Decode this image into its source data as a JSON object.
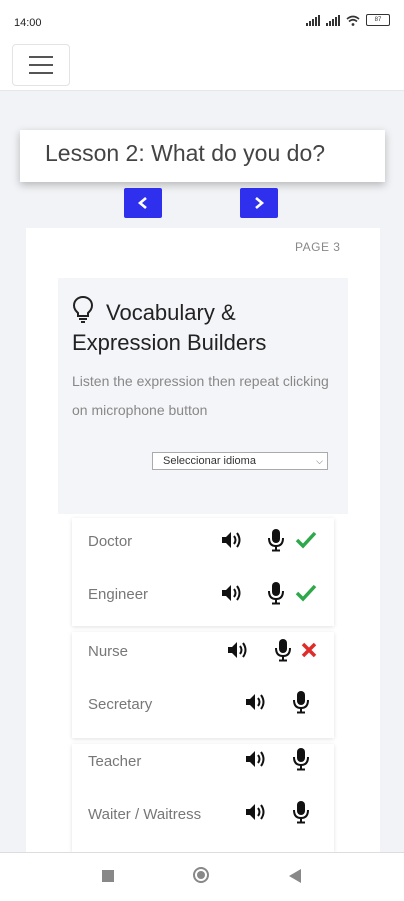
{
  "status_bar": {
    "time": "14:00",
    "battery": "87"
  },
  "lesson": {
    "title": "Lesson 2: What do you do?",
    "prev_label": "<",
    "next_label": ">"
  },
  "page": {
    "number_label": "PAGE 3"
  },
  "vocab": {
    "title": "Vocabulary & Expression Builders",
    "description": "Listen the expression then repeat clicking on microphone button",
    "language_select": "Seleccionar idioma"
  },
  "words": [
    {
      "text": "Doctor",
      "result": "correct"
    },
    {
      "text": "Engineer",
      "result": "correct"
    },
    {
      "text": "Nurse",
      "result": "wrong"
    },
    {
      "text": "Secretary",
      "result": "none"
    },
    {
      "text": "Teacher",
      "result": "none"
    },
    {
      "text": "Waiter / Waitress",
      "result": "none"
    }
  ],
  "icons": {
    "menu": "hamburger-icon",
    "bulb": "lightbulb-icon",
    "speaker": "speaker-icon",
    "mic": "microphone-icon",
    "check": "check-icon",
    "cross": "cross-icon"
  },
  "colors": {
    "accent": "#2f2fee",
    "correct": "#2ea84a",
    "wrong": "#e02b2b"
  }
}
